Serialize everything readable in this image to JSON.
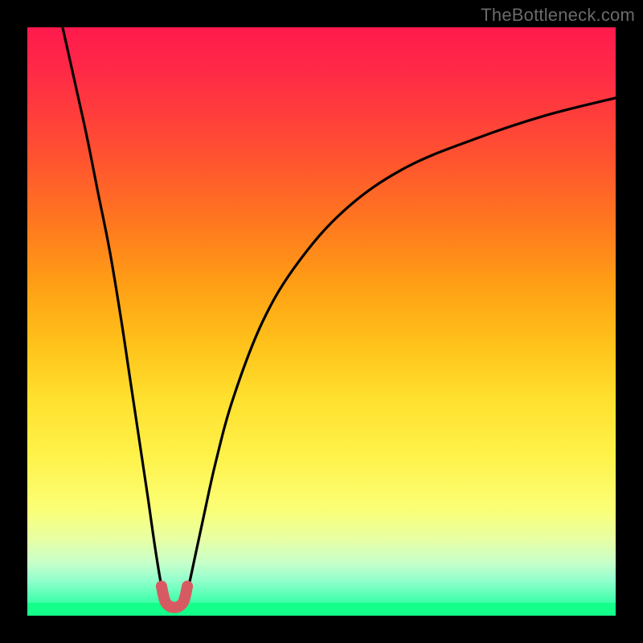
{
  "watermark": "TheBottleneck.com",
  "colors": {
    "curve": "#000000",
    "marker": "#d75a62",
    "frame": "#000000"
  },
  "chart_data": {
    "type": "line",
    "title": "",
    "xlabel": "",
    "ylabel": "",
    "xlim": [
      0,
      100
    ],
    "ylim": [
      0,
      100
    ],
    "grid": false,
    "legend": false,
    "series": [
      {
        "name": "left-branch",
        "x": [
          6,
          8,
          10,
          12,
          14,
          16,
          17.5,
          19,
          20.5,
          21.8,
          22.8,
          23.4
        ],
        "y": [
          100,
          91,
          82,
          72,
          62,
          50,
          40,
          30,
          20,
          11,
          5,
          2.5
        ]
      },
      {
        "name": "right-branch",
        "x": [
          26.6,
          27.4,
          28.5,
          30,
          32,
          35,
          40,
          46,
          54,
          64,
          76,
          88,
          100
        ],
        "y": [
          2.5,
          5,
          10,
          17,
          26,
          37,
          50,
          60,
          69,
          76,
          81,
          85,
          88
        ]
      },
      {
        "name": "trough-marker",
        "x": [
          22.8,
          23.4,
          24.2,
          25.0,
          25.8,
          26.6,
          27.2
        ],
        "y": [
          5,
          2.5,
          1.6,
          1.4,
          1.6,
          2.5,
          5
        ]
      }
    ],
    "annotations": []
  }
}
